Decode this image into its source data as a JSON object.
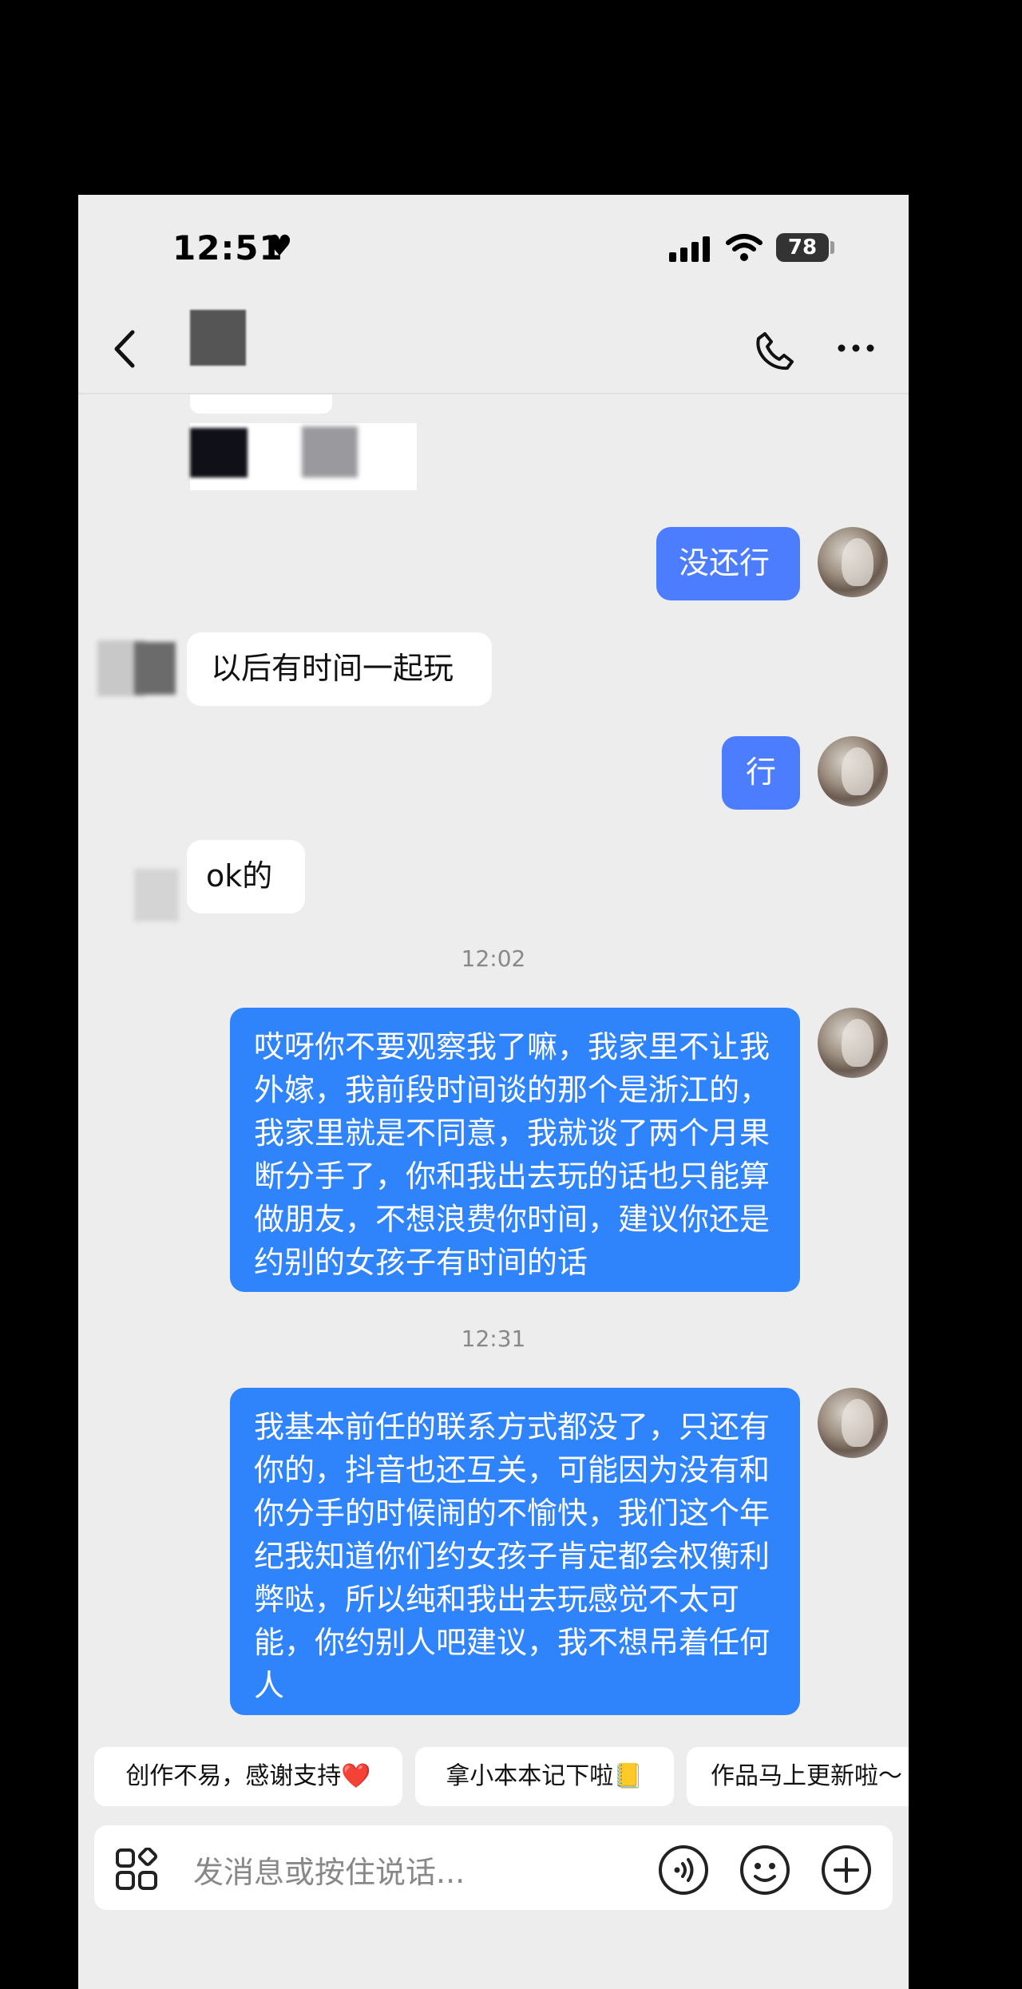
{
  "status_bar": {
    "time": "12:51",
    "battery": "78"
  },
  "header": {
    "back": "back",
    "call": "call",
    "more": "more"
  },
  "messages": [
    {
      "side": "sent",
      "text": "没还行"
    },
    {
      "side": "received",
      "text": "以后有时间一起玩"
    },
    {
      "side": "sent",
      "text": "行"
    },
    {
      "side": "received",
      "text": "ok的"
    },
    {
      "side": "sent",
      "text": "哎呀你不要观察我了嘛，我家里不让我外嫁，我前段时间谈的那个是浙江的，我家里就是不同意，我就谈了两个月果断分手了，你和我出去玩的话也只能算做朋友，不想浪费你时间，建议你还是约别的女孩子有时间的话"
    },
    {
      "side": "sent",
      "text": "我基本前任的联系方式都没了，只还有你的，抖音也还互关，可能因为没有和你分手的时候闹的不愉快，我们这个年纪我知道你们约女孩子肯定都会权衡利弊哒，所以纯和我出去玩感觉不太可能，你约别人吧建议，我不想吊着任何人"
    }
  ],
  "timestamps": [
    "12:02",
    "12:31"
  ],
  "quick_replies": [
    "创作不易，感谢支持❤️",
    "拿小本本记下啦📒",
    "作品马上更新啦～"
  ],
  "input": {
    "placeholder": "发消息或按住说话..."
  },
  "icons": {
    "back": "chevron-left-icon",
    "call": "phone-icon",
    "more": "more-icon",
    "apps": "grid-icon",
    "voice": "voice-icon",
    "emoji": "emoji-icon",
    "plus": "plus-icon"
  },
  "colors": {
    "sent_bubble": "#4d7dff",
    "sent_long_bubble": "#2f83fb",
    "received_bubble": "#ffffff",
    "background": "#ededed"
  }
}
